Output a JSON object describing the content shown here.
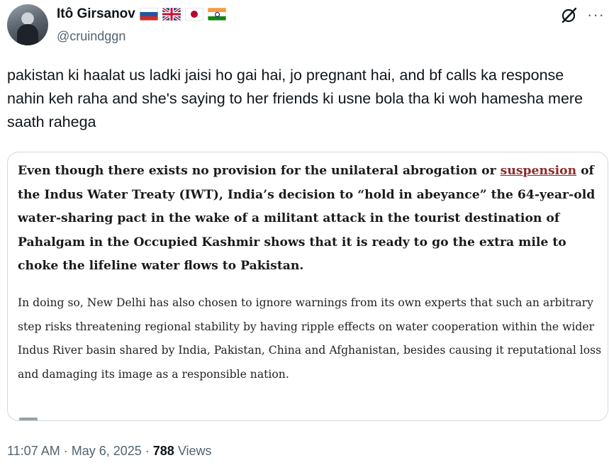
{
  "author": {
    "display_name": "Itô Girsanov",
    "handle": "@cruindggn",
    "flags": [
      "russia-flag",
      "uk-flag",
      "japan-flag",
      "india-flag"
    ]
  },
  "post": {
    "text": "pakistan ki haalat us ladki jaisi ho gai hai, jo pregnant hai, and bf calls ka response nahin keh raha and she's saying to her friends ki usne bola tha ki woh hamesha mere saath rahega",
    "image": {
      "para1_before_link": "Even though there exists no provision for the unilateral abrogation or ",
      "para1_link": "suspension",
      "para1_after_link": " of the Indus Water Treaty (IWT), India’s decision to “hold in abeyance” the 64-year-old water-sharing pact in the wake of a militant attack in the tourist destination of Pahalgam in the Occupied Kashmir shows that it is ready to go the extra mile to choke the lifeline water flows to Pakistan.",
      "para2": "In doing so, New Delhi has also chosen to ignore warnings from its own experts that such an arbitrary step risks threatening regional stability by having ripple effects on water cooperation within the wider Indus River basin shared by India, Pakistan, China and Afghanistan, besides causing it reputational loss and damaging its image as a responsible nation."
    }
  },
  "meta": {
    "time": "11:07 AM",
    "sep1": " · ",
    "date": "May 6, 2025",
    "sep2": " · ",
    "views_count": "788",
    "views_label": " Views"
  },
  "colors": {
    "text": "#0f1419",
    "secondary": "#536471",
    "border": "#cfd9de",
    "link_red": "#8b2b2b"
  },
  "icons": {
    "grok": "grok-icon",
    "more": "more-icon"
  }
}
